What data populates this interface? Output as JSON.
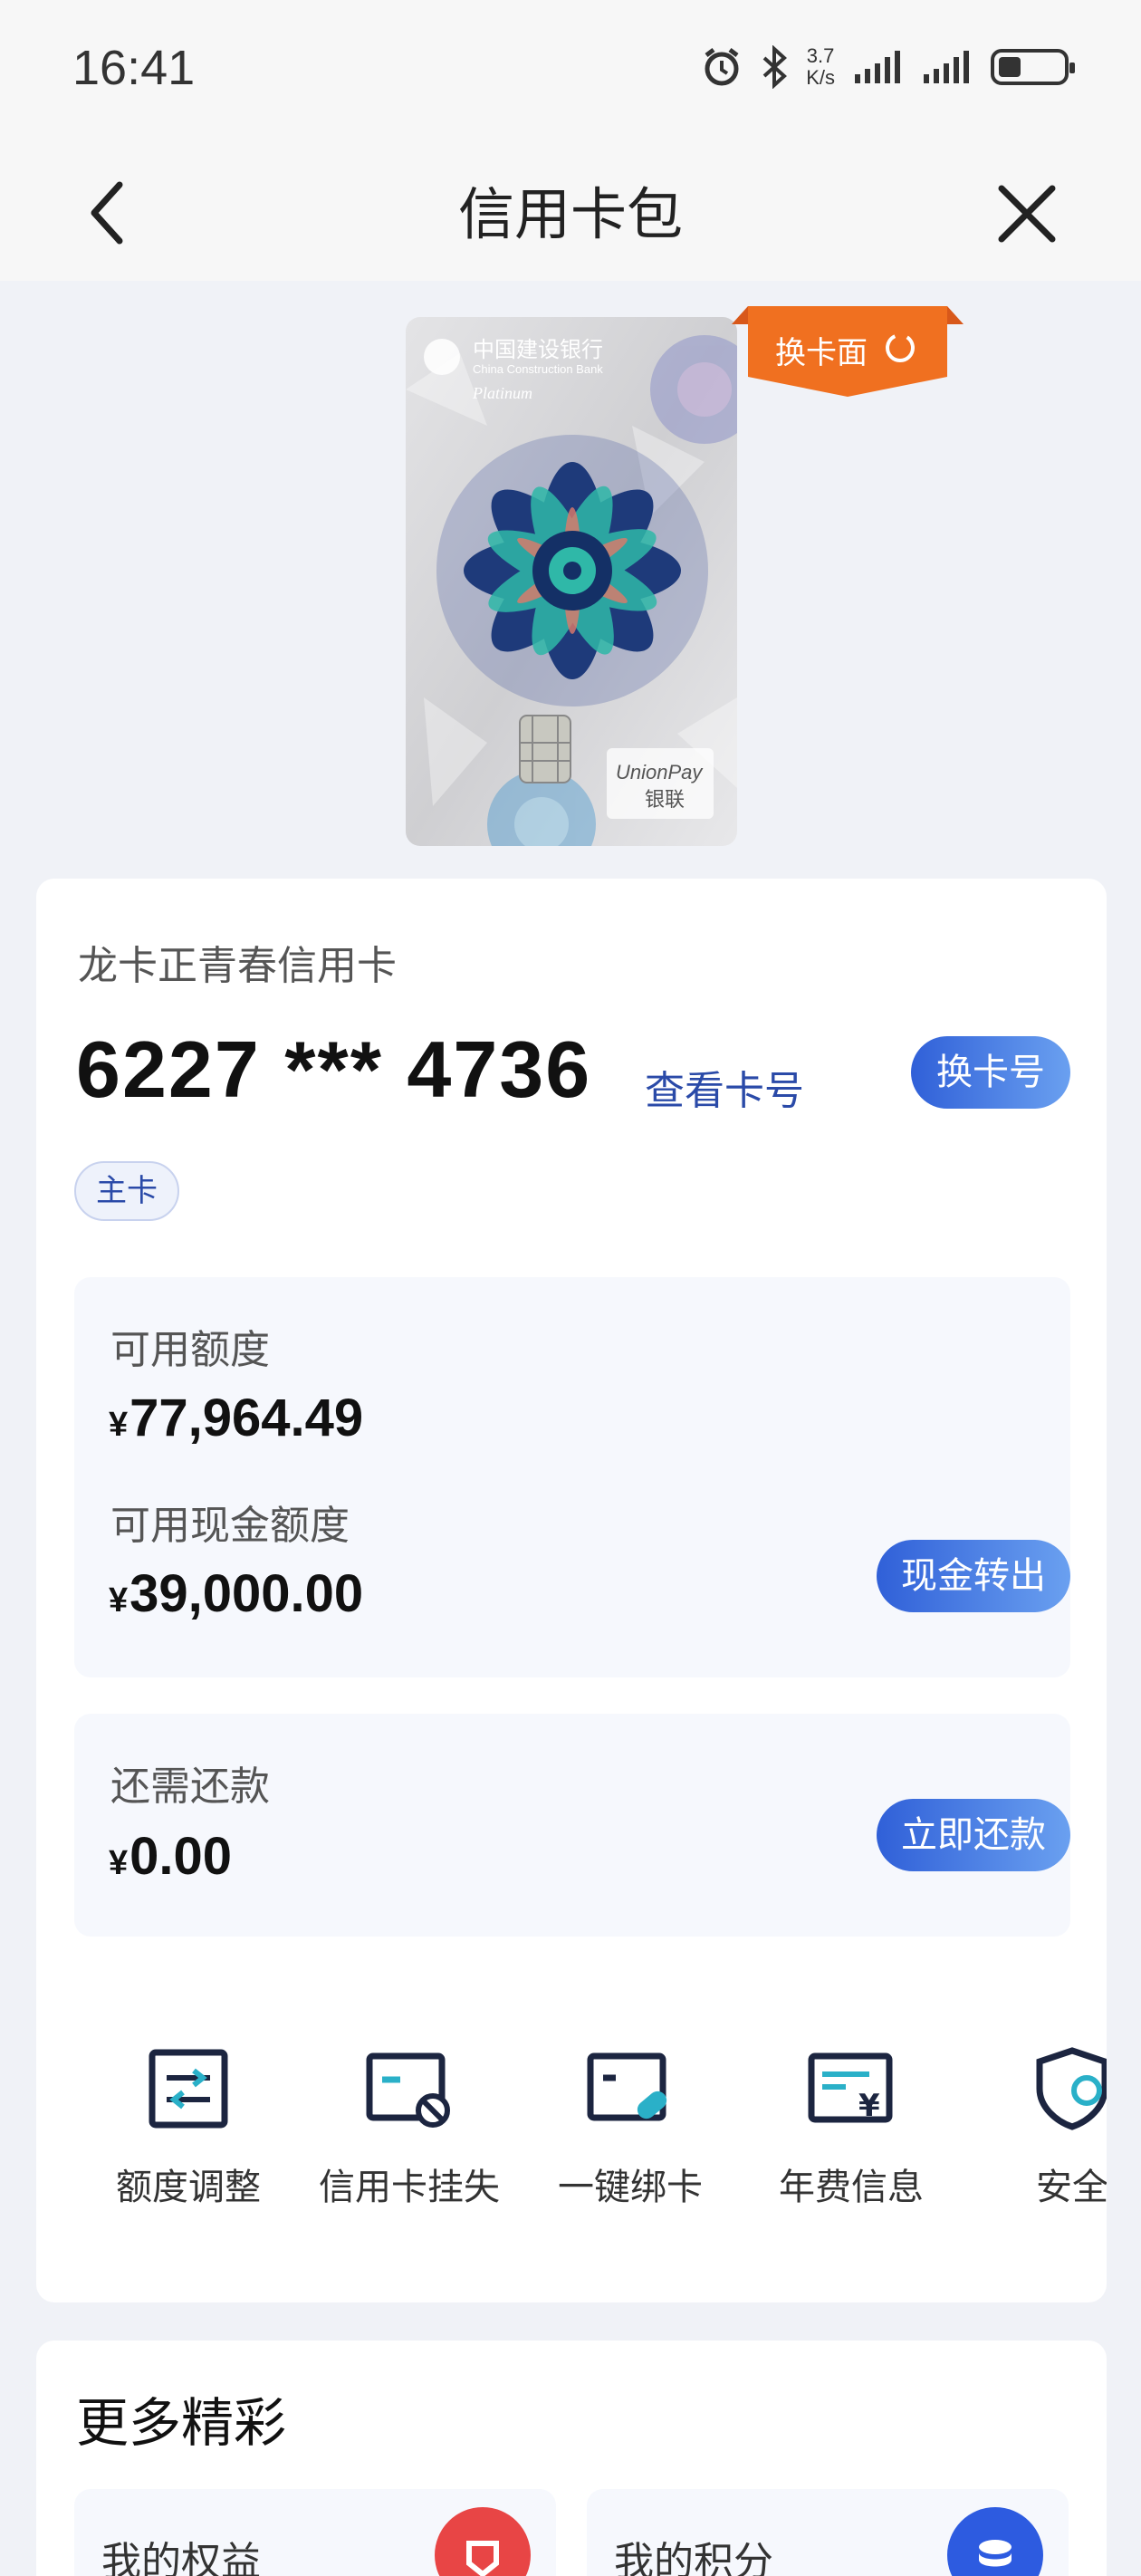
{
  "status_bar": {
    "time": "16:41",
    "net_speed_value": "3.7",
    "net_speed_unit": "K/s",
    "icons": [
      "alarm-icon",
      "bluetooth-icon",
      "signal-icon",
      "signal-icon",
      "battery-icon"
    ]
  },
  "nav": {
    "title": "信用卡包",
    "back_icon": "chevron-left-icon",
    "close_icon": "close-icon"
  },
  "card_face": {
    "bank_name_cn": "中国建设银行",
    "bank_name_en": "China Construction Bank",
    "tier": "Platinum",
    "network": "UnionPay",
    "network_cn": "银联",
    "swap_face_label": "换卡面"
  },
  "card": {
    "name": "龙卡正青春信用卡",
    "number": "6227 *** 4736",
    "view_number_link": "查看卡号",
    "change_number_button": "换卡号",
    "tag": "主卡"
  },
  "credit": {
    "available_label": "可用额度",
    "currency": "¥",
    "available_amount": "77,964.49",
    "cash_label": "可用现金额度",
    "cash_amount": "39,000.00",
    "cash_transfer_button": "现金转出"
  },
  "repay": {
    "label": "还需还款",
    "amount": "0.00",
    "repay_button": "立即还款"
  },
  "features": [
    {
      "label": "额度调整",
      "icon": "limit-adjust-icon"
    },
    {
      "label": "信用卡挂失",
      "icon": "card-loss-icon"
    },
    {
      "label": "一键绑卡",
      "icon": "bind-card-icon"
    },
    {
      "label": "年费信息",
      "icon": "annual-fee-icon"
    },
    {
      "label": "安全",
      "icon": "security-shield-icon"
    }
  ],
  "more": {
    "title": "更多精彩",
    "tiles": [
      {
        "label": "我的权益",
        "icon": "rights-icon",
        "color": "#e84545"
      },
      {
        "label": "我的积分",
        "icon": "points-icon",
        "color": "#2d5be0"
      }
    ]
  },
  "colors": {
    "accent_blue": "#2a4aa8",
    "button_gradient_start": "#3060d8",
    "button_gradient_end": "#6aa0f0",
    "swap_face_orange": "#f07020"
  }
}
